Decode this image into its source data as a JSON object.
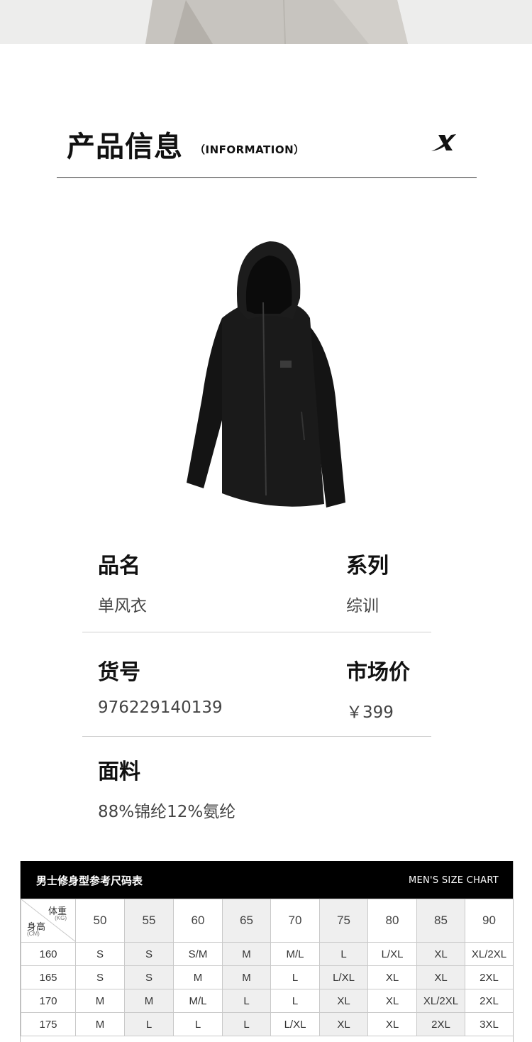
{
  "header": {
    "title": "产品信息",
    "subtitle": "（INFORMATION）",
    "brand_icon": "xtep-x-logo-icon"
  },
  "product": {
    "image_icon": "black-hooded-jacket-icon",
    "fields": {
      "name_label": "品名",
      "name_value": "单风衣",
      "series_label": "系列",
      "series_value": "综训",
      "sku_label": "货号",
      "sku_value": "976229140139",
      "price_label": "市场价",
      "price_value": "￥399",
      "fabric_label": "面料",
      "fabric_value": "88%锦纶12%氨纶"
    }
  },
  "size_chart": {
    "title": "男士修身型参考尺码表",
    "title_en": "MEN'S SIZE CHART",
    "corner": {
      "weight_label": "体重",
      "weight_unit": "(KG)",
      "height_label": "身高",
      "height_unit": "(CM)"
    },
    "weights": [
      "50",
      "55",
      "60",
      "65",
      "70",
      "75",
      "80",
      "85",
      "90"
    ],
    "rows": [
      {
        "height": "160",
        "sizes": [
          "S",
          "S",
          "S/M",
          "M",
          "M/L",
          "L",
          "L/XL",
          "XL",
          "XL/2XL"
        ]
      },
      {
        "height": "165",
        "sizes": [
          "S",
          "S",
          "M",
          "M",
          "L",
          "L/XL",
          "XL",
          "XL",
          "2XL"
        ]
      },
      {
        "height": "170",
        "sizes": [
          "M",
          "M",
          "M/L",
          "L",
          "L",
          "XL",
          "XL",
          "XL/2XL",
          "2XL"
        ]
      },
      {
        "height": "175",
        "sizes": [
          "M",
          "L",
          "L",
          "L",
          "L/XL",
          "XL",
          "XL",
          "2XL",
          "3XL"
        ]
      }
    ]
  }
}
